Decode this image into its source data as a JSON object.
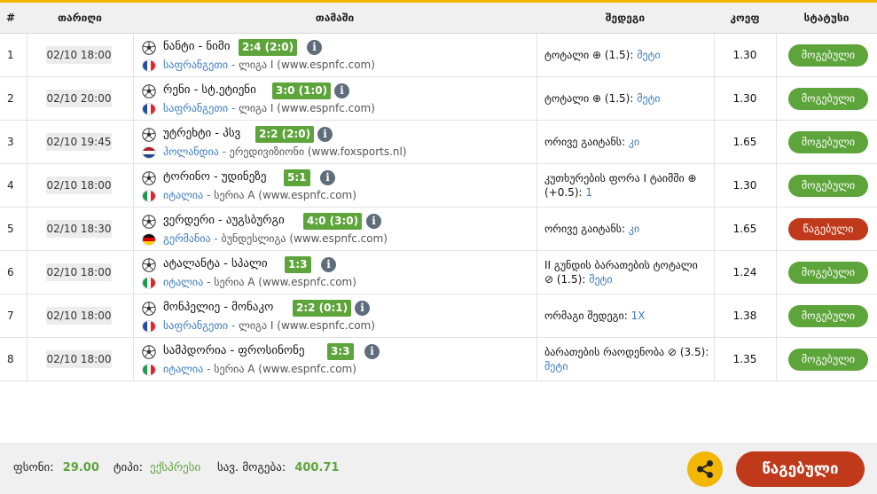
{
  "header": {
    "num": "#",
    "date": "თარიღი",
    "match": "თამაში",
    "pick": "შედეგი",
    "coef": "კოეფ",
    "status": "სტატუსი"
  },
  "rows": [
    {
      "num": "1",
      "date": "02/10 18:00",
      "match": "ნანტი - ნიმი",
      "score": "2:4 (2:0)",
      "country": "საფრანგეთი",
      "league": "ლიგა I (www.espnfc.com)",
      "flag": "fr",
      "pick_text": "ტოტალი ⊕ (1.5):",
      "pick_value": "მეტი",
      "coef": "1.30",
      "status": "მოგებული",
      "status_type": "win"
    },
    {
      "num": "2",
      "date": "02/10 20:00",
      "match": "რენი - სტ.ეტიენი",
      "score": "3:0 (1:0)",
      "country": "საფრანგეთი",
      "league": "ლიგა I (www.espnfc.com)",
      "flag": "fr",
      "pick_text": "ტოტალი ⊕ (1.5):",
      "pick_value": "მეტი",
      "coef": "1.30",
      "status": "მოგებული",
      "status_type": "win"
    },
    {
      "num": "3",
      "date": "02/10 19:45",
      "match": "უტრეხტი - პსვ",
      "score": "2:2 (2:0)",
      "country": "ჰოლანდია",
      "league": "ერედივიზიონი (www.foxsports.nl)",
      "flag": "nl",
      "pick_text": "ორივე გაიტანს:",
      "pick_value": "კი",
      "coef": "1.65",
      "status": "მოგებული",
      "status_type": "win"
    },
    {
      "num": "4",
      "date": "02/10 18:00",
      "match": "ტორინო - უდინეზე",
      "score": "5:1",
      "country": "იტალია",
      "league": "სერია A (www.espnfc.com)",
      "flag": "it",
      "pick_text": "კუთხურების ფორა I ტაიმში ⊕ (+0.5):",
      "pick_value": "1",
      "coef": "1.30",
      "status": "მოგებული",
      "status_type": "win"
    },
    {
      "num": "5",
      "date": "02/10 18:30",
      "match": "ვერდერი - აუგსბურგი",
      "score": "4:0 (3:0)",
      "country": "გერმანია",
      "league": "ბუნდესლიგა (www.espnfc.com)",
      "flag": "de",
      "pick_text": "ორივე გაიტანს:",
      "pick_value": "კი",
      "coef": "1.65",
      "status": "წაგებული",
      "status_type": "lose"
    },
    {
      "num": "6",
      "date": "02/10 18:00",
      "match": "ატალანტა - სპალი",
      "score": "1:3",
      "country": "იტალია",
      "league": "სერია A (www.espnfc.com)",
      "flag": "it",
      "pick_text": "II გუნდის ბარათების ტოტალი ⊘ (1.5):",
      "pick_value": "მეტი",
      "coef": "1.24",
      "status": "მოგებული",
      "status_type": "win"
    },
    {
      "num": "7",
      "date": "02/10 18:00",
      "match": "მონპელიე - მონაკო",
      "score": "2:2 (0:1)",
      "country": "საფრანგეთი",
      "league": "ლიგა I (www.espnfc.com)",
      "flag": "fr",
      "pick_text": "ორმაგი შედეგი:",
      "pick_value": "1X",
      "coef": "1.38",
      "status": "მოგებული",
      "status_type": "win"
    },
    {
      "num": "8",
      "date": "02/10 18:00",
      "match": "სამპდორია - ფროსინონე",
      "score": "3:3",
      "country": "იტალია",
      "league": "სერია A (www.espnfc.com)",
      "flag": "it",
      "pick_text": "ბარათების რაოდენობა ⊘ (3.5):",
      "pick_value": "მეტი",
      "coef": "1.35",
      "status": "მოგებული",
      "status_type": "win"
    }
  ],
  "footer": {
    "stake_label": "ფსონი:",
    "stake_value": "29.00",
    "type_label": "ტიპი:",
    "type_value": "ექსპრესი",
    "win_label": "სავ. მოგება:",
    "win_value": "400.71",
    "result_button": "წაგებული"
  },
  "icons": {
    "share": "share-icon",
    "info": "info-icon",
    "ball": "soccer-ball-icon"
  },
  "colors": {
    "accent": "#f2b705",
    "win": "#5da43b",
    "lose": "#c0391b",
    "link": "#3a7bbf"
  }
}
